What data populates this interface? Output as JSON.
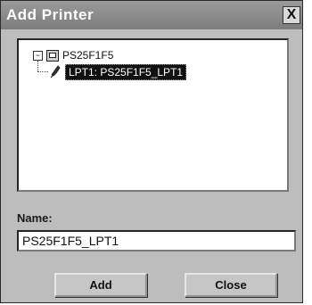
{
  "window": {
    "title": "Add Printer",
    "close_glyph": "X"
  },
  "tree": {
    "root": {
      "expander": "−",
      "icon": "computer-icon",
      "label": "PS25F1F5"
    },
    "child": {
      "icon": "printer-port-icon",
      "label": "LPT1: PS25F1F5_LPT1",
      "selected": true
    }
  },
  "name_field": {
    "label": "Name:",
    "value": "PS25F1F5_LPT1"
  },
  "buttons": {
    "add_label": "Add",
    "close_label": "Close"
  }
}
